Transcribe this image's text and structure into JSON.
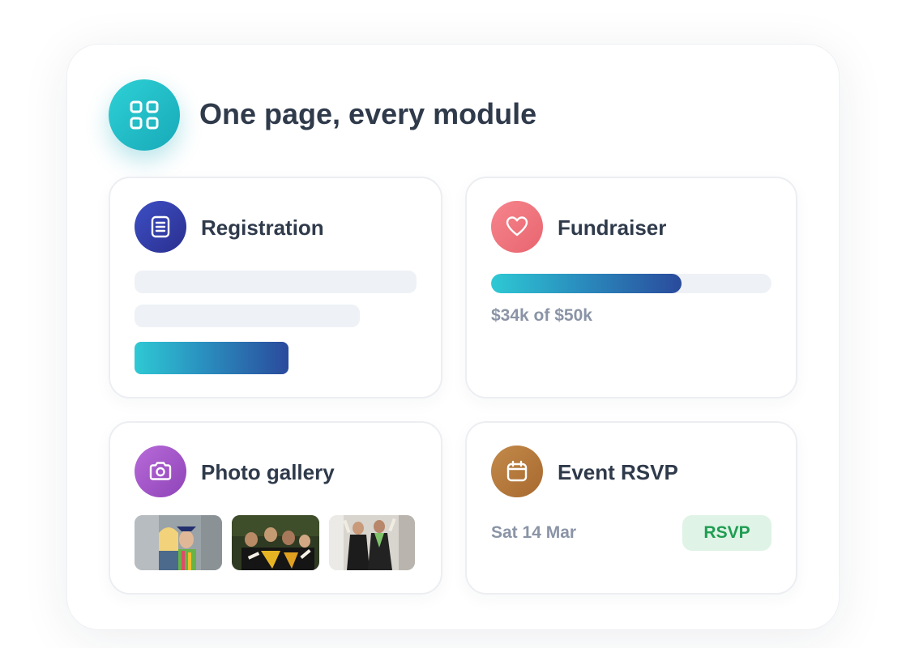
{
  "header": {
    "title": "One page, every module",
    "icon": "grid-icon",
    "accent": "#17a9b8"
  },
  "modules": {
    "registration": {
      "title": "Registration",
      "icon": "document-icon",
      "accent": "#2a2f8f"
    },
    "fundraiser": {
      "title": "Fundraiser",
      "icon": "heart-icon",
      "accent": "#e8656f",
      "progress_text": "$34k of $50k",
      "raised": 34,
      "goal": 50
    },
    "gallery": {
      "title": "Photo gallery",
      "icon": "camera-icon",
      "accent": "#8e44b8",
      "photo_count": 3
    },
    "event": {
      "title": "Event RSVP",
      "icon": "calendar-icon",
      "accent": "#a8692f",
      "date": "Sat 14 Mar",
      "rsvp_label": "RSVP",
      "rsvp_color": "#1f9d52"
    }
  }
}
